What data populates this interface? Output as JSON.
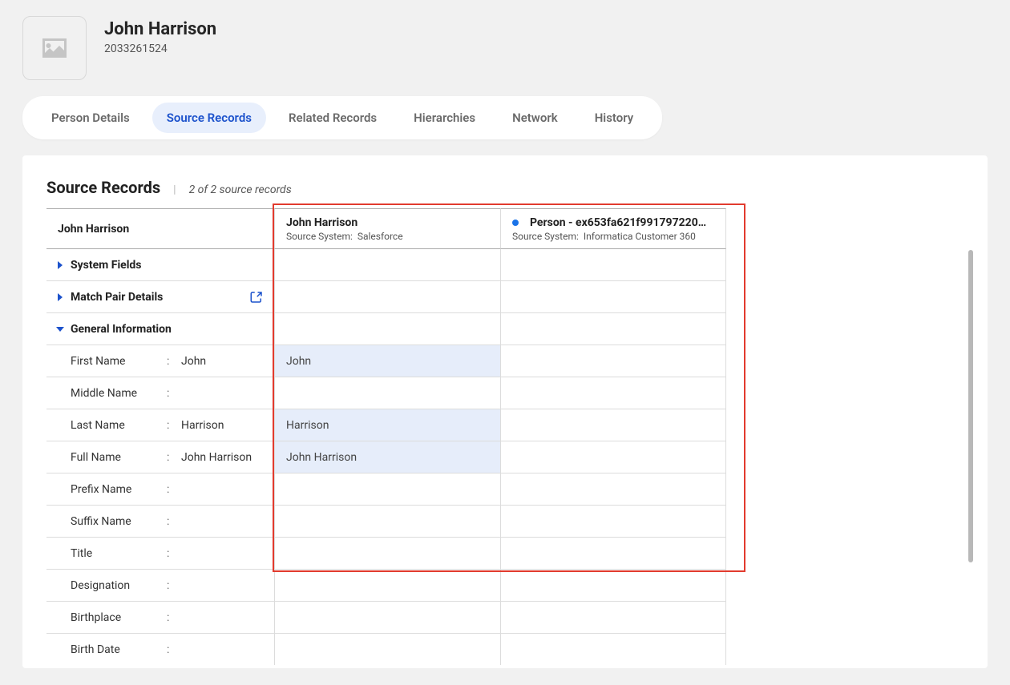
{
  "header": {
    "title": "John Harrison",
    "id": "2033261524"
  },
  "tabs": [
    {
      "label": "Person Details",
      "active": false
    },
    {
      "label": "Source Records",
      "active": true
    },
    {
      "label": "Related Records",
      "active": false
    },
    {
      "label": "Hierarchies",
      "active": false
    },
    {
      "label": "Network",
      "active": false
    },
    {
      "label": "History",
      "active": false
    }
  ],
  "panel": {
    "title": "Source Records",
    "count_text": "2 of 2 source records"
  },
  "columns": {
    "left": {
      "title": "John Harrison"
    },
    "source1": {
      "title": "John Harrison",
      "system_label": "Source System:",
      "system_value": "Salesforce"
    },
    "source2": {
      "title": "Person - ex653fa621f991797220…",
      "system_label": "Source System:",
      "system_value": "Informatica Customer 360"
    }
  },
  "sections": {
    "system_fields": "System Fields",
    "match_pair": "Match Pair Details",
    "general_info": "General Information"
  },
  "fields": [
    {
      "label": "First Name",
      "value": "John",
      "s1": "John",
      "s1_hl": true,
      "s2": ""
    },
    {
      "label": "Middle Name",
      "value": "",
      "s1": "",
      "s1_hl": false,
      "s2": ""
    },
    {
      "label": "Last Name",
      "value": "Harrison",
      "s1": "Harrison",
      "s1_hl": true,
      "s2": ""
    },
    {
      "label": "Full Name",
      "value": "John Harrison",
      "s1": "John Harrison",
      "s1_hl": true,
      "s2": ""
    },
    {
      "label": "Prefix Name",
      "value": "",
      "s1": "",
      "s1_hl": false,
      "s2": ""
    },
    {
      "label": "Suffix Name",
      "value": "",
      "s1": "",
      "s1_hl": false,
      "s2": ""
    },
    {
      "label": "Title",
      "value": "",
      "s1": "",
      "s1_hl": false,
      "s2": ""
    },
    {
      "label": "Designation",
      "value": "",
      "s1": "",
      "s1_hl": false,
      "s2": ""
    },
    {
      "label": "Birthplace",
      "value": "",
      "s1": "",
      "s1_hl": false,
      "s2": ""
    },
    {
      "label": "Birth Date",
      "value": "",
      "s1": "",
      "s1_hl": false,
      "s2": ""
    }
  ]
}
